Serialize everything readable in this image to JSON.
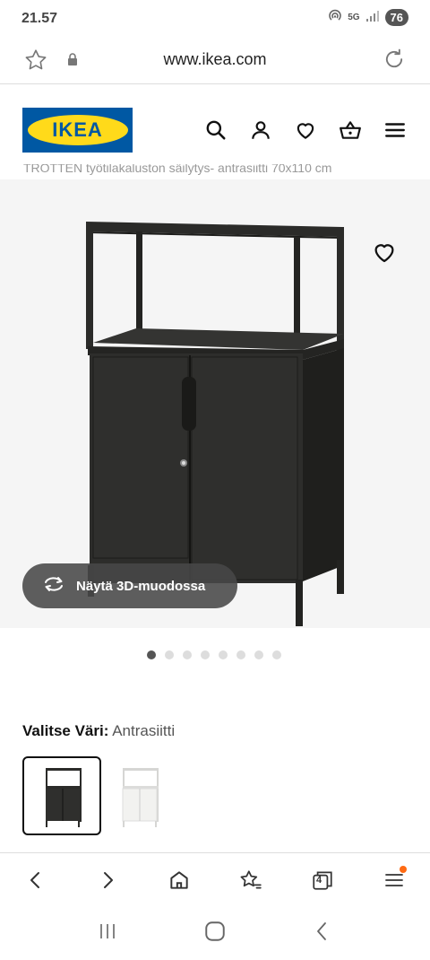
{
  "status_bar": {
    "time": "21.57",
    "network": "5G",
    "battery": "76"
  },
  "url_bar": {
    "url": "www.ikea.com"
  },
  "header": {
    "logo_text": "IKEA"
  },
  "product": {
    "truncated_heading": "TROTTEN työtilakaluston säilytys- antrasiitti 70x110 cm",
    "view_3d_label": "Näytä 3D-muodossa",
    "image_count": 8,
    "active_image": 1
  },
  "color_picker": {
    "label": "Valitse Väri:",
    "selected_value": "Antrasiitti",
    "options": [
      {
        "name": "Antrasiitti",
        "color": "#2b2b29",
        "selected": true
      },
      {
        "name": "Valkoinen",
        "color": "#f2f2f0",
        "selected": false
      }
    ]
  },
  "browser_nav": {
    "tab_count": "4"
  },
  "colors": {
    "ikea_blue": "#0058a3",
    "ikea_yellow": "#ffda1a",
    "cabinet": "#2b2b29",
    "notification": "#ff6a13"
  }
}
